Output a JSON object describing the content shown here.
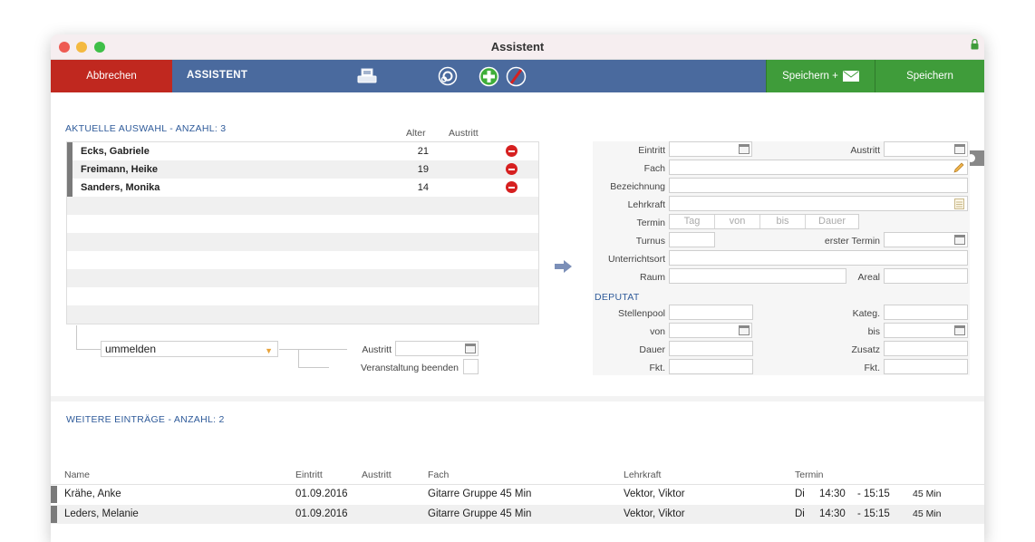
{
  "window": {
    "title": "Assistent"
  },
  "toolbar": {
    "cancel_label": "Abbrechen",
    "title": "ASSISTENT",
    "save_mail_label": "Speichern +",
    "save_label": "Speichern",
    "icons": [
      "printer-icon",
      "gear-icon",
      "add-icon",
      "remove-icon",
      "mail-icon"
    ],
    "accent_colors": {
      "cancel": "#c0281f",
      "toolbar": "#4a6a9e",
      "save": "#3f9c3a"
    }
  },
  "status_colors": [
    "#f4f045",
    "#e8322a",
    "#888888"
  ],
  "selection": {
    "title": "AKTUELLE AUSWAHL - ANZAHL: 3",
    "col_alter": "Alter",
    "col_austritt": "Austritt",
    "rows": [
      {
        "name": "Ecks, Gabriele",
        "alter": "21"
      },
      {
        "name": "Freimann, Heike",
        "alter": "19"
      },
      {
        "name": "Sanders, Monika",
        "alter": "14"
      }
    ],
    "action_select": "ummelden",
    "austritt_label": "Austritt",
    "veranstaltung_label": "Veranstaltung beenden"
  },
  "form": {
    "eintritt": "Eintritt",
    "austritt": "Austritt",
    "fach": "Fach",
    "bezeichnung": "Bezeichnung",
    "lehrkraft": "Lehrkraft",
    "termin": "Termin",
    "termin_parts": [
      "Tag",
      "von",
      "bis",
      "Dauer"
    ],
    "turnus": "Turnus",
    "erster_termin": "erster Termin",
    "unterrichtsort": "Unterrichtsort",
    "raum": "Raum",
    "areal": "Areal",
    "deputat_title": "DEPUTAT",
    "stellenpool": "Stellenpool",
    "kateg": "Kateg.",
    "von": "von",
    "bis": "bis",
    "dauer": "Dauer",
    "zusatz": "Zusatz",
    "fkt_left": "Fkt.",
    "fkt_right": "Fkt."
  },
  "further": {
    "title": "WEITERE EINTRÄGE - ANZAHL: 2",
    "columns": [
      "Name",
      "Eintritt",
      "Austritt",
      "Fach",
      "Lehrkraft",
      "Termin"
    ],
    "rows": [
      {
        "name": "Krähe, Anke",
        "eintritt": "01.09.2016",
        "austritt": "",
        "fach": "Gitarre Gruppe 45 Min",
        "lehrkraft": "Vektor, Viktor",
        "tag": "Di",
        "von": "14:30",
        "bis": "- 15:15",
        "dauer": "45 Min"
      },
      {
        "name": "Leders, Melanie",
        "eintritt": "01.09.2016",
        "austritt": "",
        "fach": "Gitarre Gruppe 45 Min",
        "lehrkraft": "Vektor, Viktor",
        "tag": "Di",
        "von": "14:30",
        "bis": "- 15:15",
        "dauer": "45 Min"
      }
    ]
  }
}
